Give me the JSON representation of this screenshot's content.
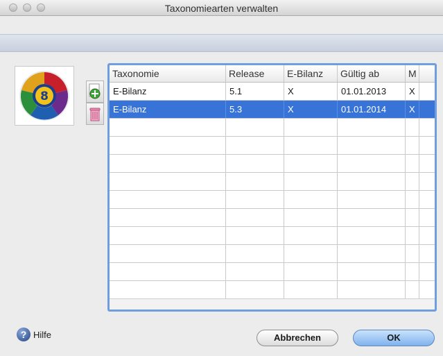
{
  "window": {
    "title": "Taxonomiearten verwalten"
  },
  "table": {
    "columns": [
      "Taxonomie",
      "Release",
      "E-Bilanz",
      "Gültig ab",
      "M"
    ],
    "rows": [
      {
        "taxonomie": "E-Bilanz",
        "release": "5.1",
        "ebilanz": "X",
        "gueltig_ab": "01.01.2013",
        "m": "X",
        "selected": false
      },
      {
        "taxonomie": "E-Bilanz",
        "release": "5.3",
        "ebilanz": "X",
        "gueltig_ab": "01.01.2014",
        "m": "X",
        "selected": true
      }
    ]
  },
  "toolbar": {
    "add_icon": "add-icon",
    "delete_icon": "trash-icon"
  },
  "footer": {
    "help_label": "Hilfe",
    "cancel_label": "Abbrechen",
    "ok_label": "OK"
  },
  "colors": {
    "selection": "#3874d8",
    "table_border": "#6f9ede",
    "ok_button": "#7fb3ee"
  }
}
